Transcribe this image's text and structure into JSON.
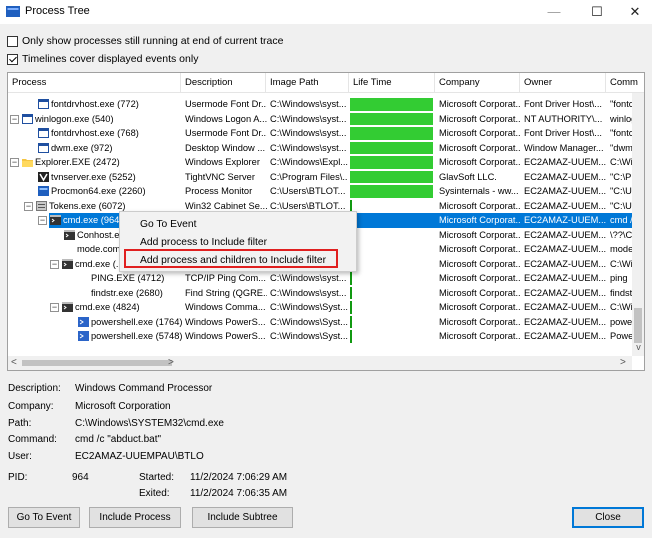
{
  "window": {
    "title": "Process Tree",
    "minimize": "—",
    "maximize": "☐",
    "close": "✕"
  },
  "options": {
    "only_running": {
      "label": "Only show processes still running at end of current trace",
      "checked": false
    },
    "timelines_cover": {
      "label": "Timelines cover displayed events only",
      "checked": true
    }
  },
  "columns": [
    "Process",
    "Description",
    "Image Path",
    "Life Time",
    "Company",
    "Owner",
    "Comm"
  ],
  "rows": [
    {
      "name": "fontdrvhost.exe (772)",
      "desc": "Usermode Font Dr...",
      "path": "C:\\Windows\\syst...",
      "company": "Microsoft Corporat...",
      "owner": "Font Driver Host\\...",
      "cmd": "\"fontc",
      "icon": "app-icon"
    },
    {
      "name": "winlogon.exe (540)",
      "desc": "Windows Logon A...",
      "path": "C:\\Windows\\syst...",
      "company": "Microsoft Corporat...",
      "owner": "NT AUTHORITY\\...",
      "cmd": "winlog",
      "icon": "app-icon"
    },
    {
      "name": "fontdrvhost.exe (768)",
      "desc": "Usermode Font Dr...",
      "path": "C:\\Windows\\syst...",
      "company": "Microsoft Corporat...",
      "owner": "Font Driver Host\\...",
      "cmd": "\"fontc",
      "icon": "app-icon"
    },
    {
      "name": "dwm.exe (972)",
      "desc": "Desktop Window ...",
      "path": "C:\\Windows\\syst...",
      "company": "Microsoft Corporat...",
      "owner": "Window Manager...",
      "cmd": "\"dwm",
      "icon": "app-icon"
    },
    {
      "name": "Explorer.EXE (2472)",
      "desc": "Windows Explorer",
      "path": "C:\\Windows\\Expl...",
      "company": "Microsoft Corporat...",
      "owner": "EC2AMAZ-UUEM...",
      "cmd": "C:\\Wi",
      "icon": "folder-icon"
    },
    {
      "name": "tvnserver.exe (5252)",
      "desc": "TightVNC Server",
      "path": "C:\\Program Files\\...",
      "company": "GlavSoft LLC.",
      "owner": "EC2AMAZ-UUEM...",
      "cmd": "\"C:\\P",
      "icon": "vnc-icon"
    },
    {
      "name": "Procmon64.exe (2260)",
      "desc": "Process Monitor",
      "path": "C:\\Users\\BTLOT...",
      "company": "Sysinternals - ww...",
      "owner": "EC2AMAZ-UUEM...",
      "cmd": "\"C:\\U",
      "icon": "procmon-icon"
    },
    {
      "name": "Tokens.exe (6072)",
      "desc": "Win32 Cabinet Se...",
      "path": "C:\\Users\\BTLOT...",
      "company": "Microsoft Corporat...",
      "owner": "EC2AMAZ-UUEM...",
      "cmd": "\"C:\\U",
      "icon": "cabinet-icon"
    },
    {
      "name": "cmd.exe (964)",
      "desc": "Windows Comma...",
      "path": "C:\\Windows\\SYS...",
      "company": "Microsoft Corporat...",
      "owner": "EC2AMAZ-UUEM...",
      "cmd": "cmd /",
      "icon": "console-icon"
    },
    {
      "name": "Conhost.exe (...)",
      "desc": "",
      "path": "",
      "company": "Microsoft Corporat...",
      "owner": "EC2AMAZ-UUEM...",
      "cmd": "\\??\\C",
      "icon": "console-icon"
    },
    {
      "name": "mode.com (...)",
      "desc": "",
      "path": "",
      "company": "Microsoft Corporat...",
      "owner": "EC2AMAZ-UUEM...",
      "cmd": "mode",
      "icon": ""
    },
    {
      "name": "cmd.exe (...)",
      "desc": "",
      "path": "",
      "company": "Microsoft Corporat...",
      "owner": "EC2AMAZ-UUEM...",
      "cmd": "C:\\Wi",
      "icon": "console-icon"
    },
    {
      "name": "PING.EXE (4712)",
      "desc": "TCP/IP Ping Com...",
      "path": "C:\\Windows\\syst...",
      "company": "Microsoft Corporat...",
      "owner": "EC2AMAZ-UUEM...",
      "cmd": "ping",
      "icon": ""
    },
    {
      "name": "findstr.exe (2680)",
      "desc": "Find String (QGRE...",
      "path": "C:\\Windows\\syst...",
      "company": "Microsoft Corporat...",
      "owner": "EC2AMAZ-UUEM...",
      "cmd": "findstr",
      "icon": ""
    },
    {
      "name": "cmd.exe (4824)",
      "desc": "Windows Comma...",
      "path": "C:\\Windows\\Syst...",
      "company": "Microsoft Corporat...",
      "owner": "EC2AMAZ-UUEM...",
      "cmd": "C:\\Wi",
      "icon": "console-icon"
    },
    {
      "name": "powershell.exe (1764)",
      "desc": "Windows PowerS...",
      "path": "C:\\Windows\\Syst...",
      "company": "Microsoft Corporat...",
      "owner": "EC2AMAZ-UUEM...",
      "cmd": "power",
      "icon": "powershell-icon"
    },
    {
      "name": "powershell.exe (5748)",
      "desc": "Windows PowerS...",
      "path": "C:\\Windows\\Syst...",
      "company": "Microsoft Corporat...",
      "owner": "EC2AMAZ-UUEM...",
      "cmd": "Powe",
      "icon": "powershell-icon"
    }
  ],
  "context_menu": {
    "items": [
      "Go To Event",
      "Add process to Include filter",
      "Add process and children to Include filter"
    ]
  },
  "details": {
    "description_label": "Description:",
    "description": "Windows Command Processor",
    "company_label": "Company:",
    "company": "Microsoft Corporation",
    "path_label": "Path:",
    "path": "C:\\Windows\\SYSTEM32\\cmd.exe",
    "command_label": "Command:",
    "command": "cmd /c \"abduct.bat\"",
    "user_label": "User:",
    "user": "EC2AMAZ-UUEMPAU\\BTLO",
    "pid_label": "PID:",
    "pid": "964",
    "started_label": "Started:",
    "started": "11/2/2024 7:06:29 AM",
    "exited_label": "Exited:",
    "exited": "11/2/2024 7:06:35 AM"
  },
  "buttons": {
    "go_to_event": "Go To Event",
    "include_process": "Include Process",
    "include_subtree": "Include Subtree",
    "close": "Close"
  },
  "colors": {
    "selection": "#0078d7",
    "lifetime": "#33cc33",
    "highlight_box": "#e02020"
  },
  "scroll": {
    "left_arrow": "<",
    "right_arrow": ">",
    "up_arrow": "^",
    "down_arrow": "v"
  }
}
